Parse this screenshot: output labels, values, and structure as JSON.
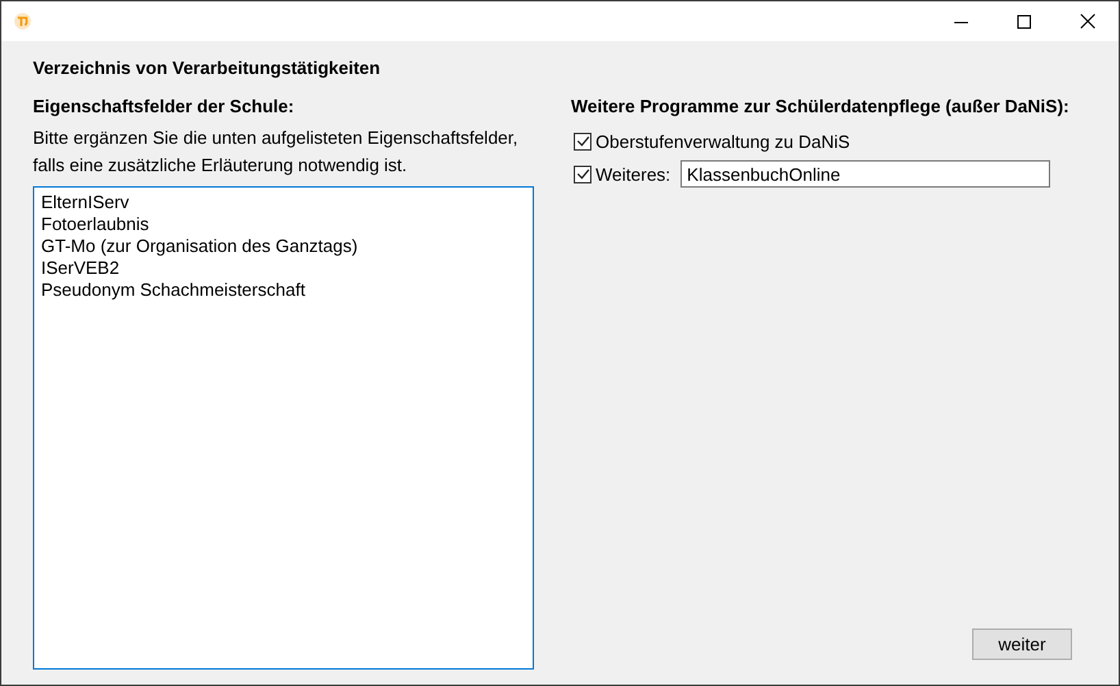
{
  "heading": "Verzeichnis von Verarbeitungstätigkeiten",
  "left": {
    "heading": "Eigenschaftsfelder der Schule:",
    "description": "Bitte ergänzen Sie die unten aufgelisteten Eigenschaftsfelder, falls eine zusätzliche Erläuterung notwendig ist.",
    "lines": [
      "ElternIServ",
      "Fotoerlaubnis",
      "GT-Mo (zur Organisation des Ganztags)",
      "ISerVEB2",
      "Pseudonym Schachmeisterschaft"
    ]
  },
  "right": {
    "heading": "Weitere Programme zur Schülerdatenpflege (außer DaNiS):",
    "options": [
      {
        "kind": "checkbox",
        "label": "Oberstufenverwaltung zu DaNiS",
        "checked": true
      },
      {
        "kind": "checkbox_field",
        "label": "Weiteres:",
        "checked": true,
        "value": "KlassenbuchOnline"
      }
    ]
  },
  "button": "weiter"
}
